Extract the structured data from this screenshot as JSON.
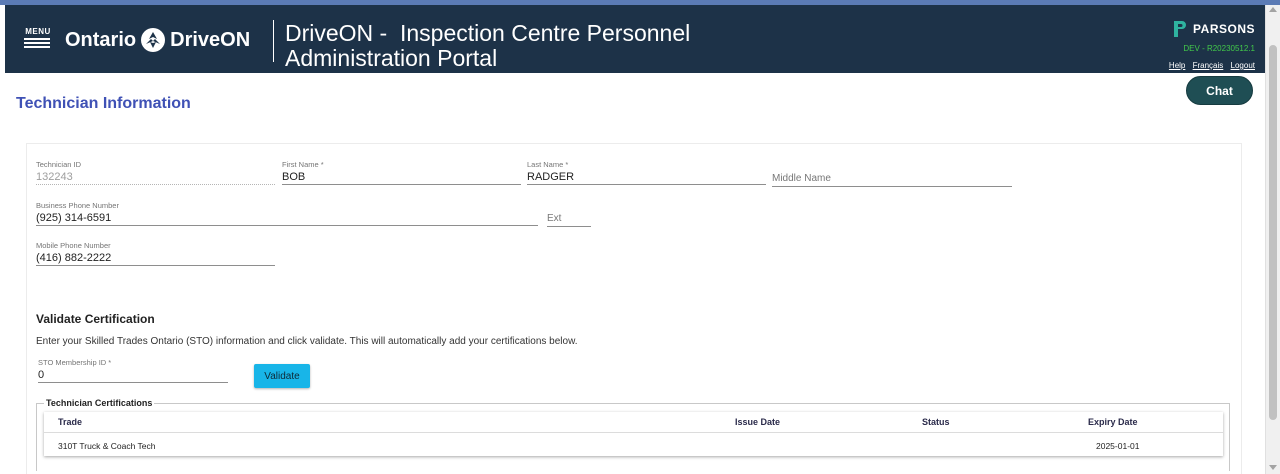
{
  "header": {
    "menu_label": "MENU",
    "logo_left": "Ontario",
    "logo_right": "DriveON",
    "portal_title_line1": "DriveON -  Inspection Centre Personnel",
    "portal_title_line2": "Administration Portal",
    "brand": "PARSONS",
    "env": "DEV - R20230512.1",
    "links": [
      "Help",
      "Français",
      "Logout"
    ]
  },
  "page": {
    "title": "Technician Information",
    "chat_label": "Chat"
  },
  "form": {
    "technician_id": {
      "label": "Technician ID",
      "value": "132243"
    },
    "first_name": {
      "label": "First Name *",
      "value": "BOB"
    },
    "last_name": {
      "label": "Last Name *",
      "value": "RADGER"
    },
    "middle_name": {
      "placeholder": "Middle Name"
    },
    "business_phone": {
      "label": "Business Phone Number",
      "value": "(925) 314-6591"
    },
    "ext": {
      "placeholder": "Ext"
    },
    "mobile_phone": {
      "label": "Mobile Phone Number",
      "value": "(416) 882-2222"
    }
  },
  "validate": {
    "title": "Validate Certification",
    "instructions": "Enter your Skilled Trades Ontario (STO) information and click validate. This will automatically add your certifications below.",
    "sto_label": "STO Membership ID *",
    "sto_value": "0",
    "button_label": "Validate"
  },
  "certifications": {
    "legend": "Technician Certifications",
    "columns": [
      "Trade",
      "Issue Date",
      "Status",
      "Expiry Date"
    ],
    "rows": [
      {
        "trade": "310T Truck & Coach Tech",
        "issue_date": "",
        "status": "",
        "expiry_date": "2025-01-01"
      }
    ]
  },
  "colors": {
    "header_bg": "#1d3248",
    "title_blue": "#3f51b5",
    "chat_bg": "#1f4e54",
    "validate_bg": "#18b5e8",
    "env_green": "#42c94a"
  }
}
